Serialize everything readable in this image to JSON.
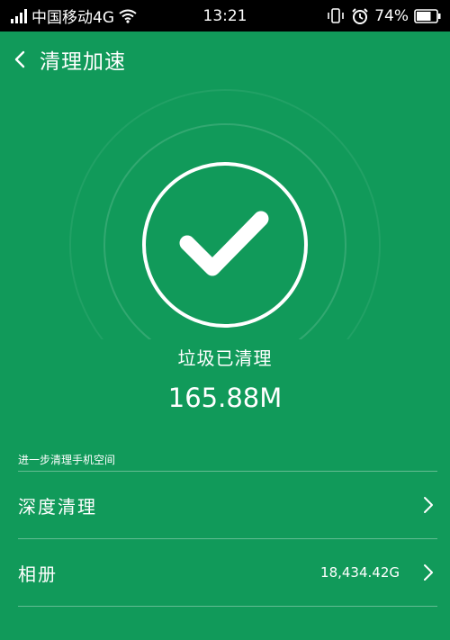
{
  "status_bar": {
    "carrier": "中国移动4G",
    "time": "13:21",
    "battery": "74%",
    "battery_level": 0.74,
    "icons": [
      "signal-icon",
      "wifi-icon",
      "vibrate-icon",
      "alarm-icon",
      "battery-icon"
    ]
  },
  "header": {
    "title": "清理加速",
    "back_icon": "chevron-left-icon"
  },
  "result": {
    "status": "垃圾已清理",
    "size": "165.88M",
    "icon": "checkmark-icon"
  },
  "section": {
    "title": "进一步清理手机空间",
    "items": [
      {
        "label": "深度清理",
        "value": "",
        "icon": "chevron-right-icon"
      },
      {
        "label": "相册",
        "value": "18,434.42G",
        "icon": "chevron-right-icon"
      }
    ]
  },
  "colors": {
    "background": "#119A5A",
    "status_bar": "#000000",
    "text": "#FFFFFF"
  }
}
